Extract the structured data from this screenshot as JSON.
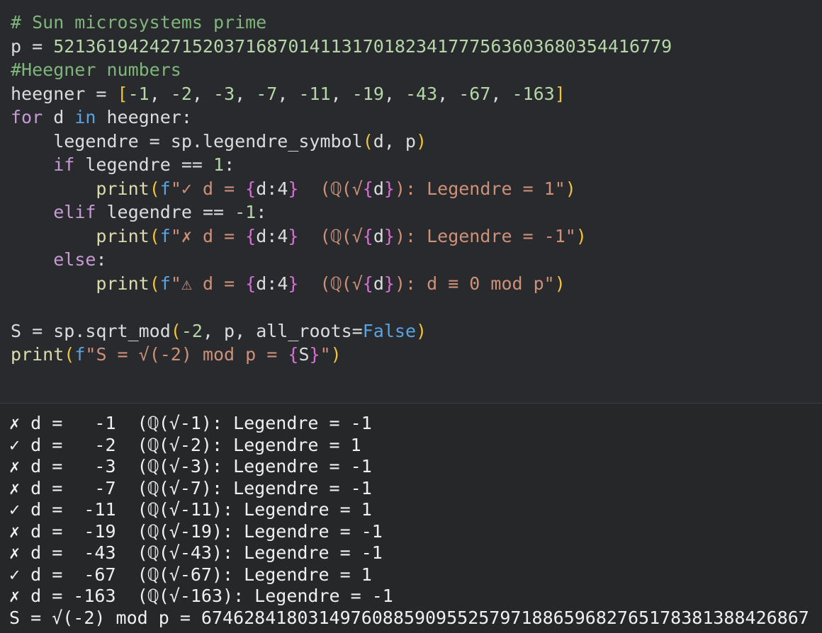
{
  "editor": {
    "lines": [
      [
        {
          "t": "# Sun microsystems prime",
          "c": "cm"
        }
      ],
      [
        {
          "t": "p = ",
          "c": "txt"
        },
        {
          "t": "521361942427152037168701411317018234177756360368035441677​9",
          "c": "num"
        }
      ],
      [
        {
          "t": "#Heegner numbers",
          "c": "cm"
        }
      ],
      [
        {
          "t": "heegner = ",
          "c": "txt"
        },
        {
          "t": "[",
          "c": "br"
        },
        {
          "t": "-1",
          "c": "num"
        },
        {
          "t": ", ",
          "c": "txt"
        },
        {
          "t": "-2",
          "c": "num"
        },
        {
          "t": ", ",
          "c": "txt"
        },
        {
          "t": "-3",
          "c": "num"
        },
        {
          "t": ", ",
          "c": "txt"
        },
        {
          "t": "-7",
          "c": "num"
        },
        {
          "t": ", ",
          "c": "txt"
        },
        {
          "t": "-11",
          "c": "num"
        },
        {
          "t": ", ",
          "c": "txt"
        },
        {
          "t": "-19",
          "c": "num"
        },
        {
          "t": ", ",
          "c": "txt"
        },
        {
          "t": "-43",
          "c": "num"
        },
        {
          "t": ", ",
          "c": "txt"
        },
        {
          "t": "-67",
          "c": "num"
        },
        {
          "t": ", ",
          "c": "txt"
        },
        {
          "t": "-163",
          "c": "num"
        },
        {
          "t": "]",
          "c": "br"
        }
      ],
      [
        {
          "t": "for",
          "c": "kw"
        },
        {
          "t": " d ",
          "c": "txt"
        },
        {
          "t": "in",
          "c": "blue"
        },
        {
          "t": " heegner:",
          "c": "txt"
        }
      ],
      [
        {
          "t": "    legendre = sp.legendre_symbol",
          "c": "txt"
        },
        {
          "t": "(",
          "c": "br"
        },
        {
          "t": "d, p",
          "c": "txt"
        },
        {
          "t": ")",
          "c": "br"
        }
      ],
      [
        {
          "t": "    ",
          "c": "txt"
        },
        {
          "t": "if",
          "c": "kw"
        },
        {
          "t": " legendre == ",
          "c": "txt"
        },
        {
          "t": "1",
          "c": "num"
        },
        {
          "t": ":",
          "c": "txt"
        }
      ],
      [
        {
          "t": "        ",
          "c": "txt"
        },
        {
          "t": "print",
          "c": "fn"
        },
        {
          "t": "(",
          "c": "br"
        },
        {
          "t": "f",
          "c": "blue"
        },
        {
          "t": "\"✓ d = ",
          "c": "str"
        },
        {
          "t": "{",
          "c": "br2"
        },
        {
          "t": "d:4",
          "c": "txt"
        },
        {
          "t": "}",
          "c": "br2"
        },
        {
          "t": "  (ℚ(√",
          "c": "str"
        },
        {
          "t": "{",
          "c": "br2"
        },
        {
          "t": "d",
          "c": "txt"
        },
        {
          "t": "}",
          "c": "br2"
        },
        {
          "t": "): Legendre = 1\"",
          "c": "str"
        },
        {
          "t": ")",
          "c": "br"
        }
      ],
      [
        {
          "t": "    ",
          "c": "txt"
        },
        {
          "t": "elif",
          "c": "kw"
        },
        {
          "t": " legendre == ",
          "c": "txt"
        },
        {
          "t": "-1",
          "c": "num"
        },
        {
          "t": ":",
          "c": "txt"
        }
      ],
      [
        {
          "t": "        ",
          "c": "txt"
        },
        {
          "t": "print",
          "c": "fn"
        },
        {
          "t": "(",
          "c": "br"
        },
        {
          "t": "f",
          "c": "blue"
        },
        {
          "t": "\"✗ d = ",
          "c": "str"
        },
        {
          "t": "{",
          "c": "br2"
        },
        {
          "t": "d:4",
          "c": "txt"
        },
        {
          "t": "}",
          "c": "br2"
        },
        {
          "t": "  (ℚ(√",
          "c": "str"
        },
        {
          "t": "{",
          "c": "br2"
        },
        {
          "t": "d",
          "c": "txt"
        },
        {
          "t": "}",
          "c": "br2"
        },
        {
          "t": "): Legendre = -1\"",
          "c": "str"
        },
        {
          "t": ")",
          "c": "br"
        }
      ],
      [
        {
          "t": "    ",
          "c": "txt"
        },
        {
          "t": "else",
          "c": "kw"
        },
        {
          "t": ":",
          "c": "txt"
        }
      ],
      [
        {
          "t": "        ",
          "c": "txt"
        },
        {
          "t": "print",
          "c": "fn"
        },
        {
          "t": "(",
          "c": "br"
        },
        {
          "t": "f",
          "c": "blue"
        },
        {
          "t": "\"⚠ d = ",
          "c": "str"
        },
        {
          "t": "{",
          "c": "br2"
        },
        {
          "t": "d:4",
          "c": "txt"
        },
        {
          "t": "}",
          "c": "br2"
        },
        {
          "t": "  (ℚ(√",
          "c": "str"
        },
        {
          "t": "{",
          "c": "br2"
        },
        {
          "t": "d",
          "c": "txt"
        },
        {
          "t": "}",
          "c": "br2"
        },
        {
          "t": "): d ≡ 0 mod p\"",
          "c": "str"
        },
        {
          "t": ")",
          "c": "br"
        }
      ],
      [],
      [
        {
          "t": "S = sp.sqrt_mod",
          "c": "txt"
        },
        {
          "t": "(",
          "c": "br"
        },
        {
          "t": "-2",
          "c": "num"
        },
        {
          "t": ", p, all_roots=",
          "c": "txt"
        },
        {
          "t": "False",
          "c": "blue"
        },
        {
          "t": ")",
          "c": "br"
        }
      ],
      [
        {
          "t": "print",
          "c": "fn"
        },
        {
          "t": "(",
          "c": "br"
        },
        {
          "t": "f",
          "c": "blue"
        },
        {
          "t": "\"S = √(-2) mod p = ",
          "c": "str"
        },
        {
          "t": "{",
          "c": "br2"
        },
        {
          "t": "S",
          "c": "txt"
        },
        {
          "t": "}",
          "c": "br2"
        },
        {
          "t": "\"",
          "c": "str"
        },
        {
          "t": ")",
          "c": "br"
        }
      ]
    ]
  },
  "output": {
    "lines": [
      "✗ d =   -1  (ℚ(√-1): Legendre = -1",
      "✓ d =   -2  (ℚ(√-2): Legendre = 1",
      "✗ d =   -3  (ℚ(√-3): Legendre = -1",
      "✗ d =   -7  (ℚ(√-7): Legendre = -1",
      "✓ d =  -11  (ℚ(√-11): Legendre = 1",
      "✗ d =  -19  (ℚ(√-19): Legendre = -1",
      "✗ d =  -43  (ℚ(√-43): Legendre = -1",
      "✓ d =  -67  (ℚ(√-67): Legendre = 1",
      "✗ d = -163  (ℚ(√-163): Legendre = -1",
      "S = √(-2) mod p = 6746284180314976088590955257971886596827651783813884​26867"
    ]
  }
}
